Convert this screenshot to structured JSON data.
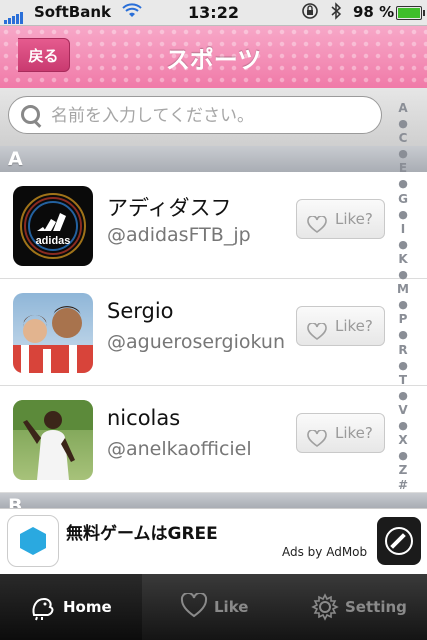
{
  "status": {
    "carrier": "SoftBank",
    "time": "13:22",
    "battery": "98 %"
  },
  "nav": {
    "title": "スポーツ",
    "back_label": "戻る"
  },
  "search": {
    "placeholder": "名前を入力してください。"
  },
  "sections": {
    "a": "A",
    "b": "B"
  },
  "rows": [
    {
      "name": "アディダスフ",
      "handle": "@adidasFTB_jp",
      "like_label": "Like?"
    },
    {
      "name": "Sergio",
      "handle": "@aguerosergiokun",
      "like_label": "Like?"
    },
    {
      "name": "nicolas",
      "handle": "@anelkaofficiel",
      "like_label": "Like?"
    }
  ],
  "index": [
    "A",
    "●",
    "C",
    "●",
    "E",
    "●",
    "G",
    "●",
    "I",
    "●",
    "K",
    "●",
    "M",
    "●",
    "P",
    "●",
    "R",
    "●",
    "T",
    "●",
    "V",
    "●",
    "X",
    "●",
    "Z",
    "#"
  ],
  "ad": {
    "title": "無料ゲームはGREE",
    "by": "Ads by AdMob"
  },
  "tabs": [
    {
      "label": "Home",
      "icon": "bird-icon",
      "active": true
    },
    {
      "label": "Like",
      "icon": "heart-icon",
      "active": false
    },
    {
      "label": "Setting",
      "icon": "gear-icon",
      "active": false
    }
  ],
  "colors": {
    "nav_pink": "#f07aa8",
    "back_button": "#c93a70",
    "tabbar": "#141414"
  }
}
